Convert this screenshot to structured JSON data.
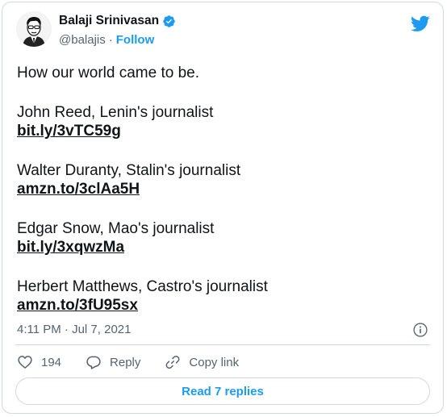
{
  "author": {
    "name": "Balaji Srinivasan",
    "handle": "@balajis",
    "separator": "·",
    "follow_label": "Follow"
  },
  "tweet": {
    "intro": "How our world came to be.",
    "entries": [
      {
        "text": "John Reed, Lenin's journalist",
        "link": "bit.ly/3vTC59g"
      },
      {
        "text": "Walter Duranty, Stalin's journalist",
        "link": "amzn.to/3clAa5H"
      },
      {
        "text": "Edgar Snow, Mao's journalist",
        "link": "bit.ly/3xqwzMa"
      },
      {
        "text": "Herbert Matthews, Castro's journalist",
        "link": "amzn.to/3fU95sx"
      }
    ],
    "timestamp": "4:11 PM · Jul 7, 2021"
  },
  "actions": {
    "like_count": "194",
    "reply_label": "Reply",
    "copy_link_label": "Copy link"
  },
  "read_replies_label": "Read 7 replies",
  "colors": {
    "accent": "#1d9bf0",
    "text": "#0f1419",
    "secondary": "#536471",
    "border": "#cfd9de"
  },
  "icons": [
    "avatar",
    "verified-badge-icon",
    "twitter-bird-icon",
    "info-icon",
    "heart-icon",
    "reply-icon",
    "link-icon"
  ]
}
